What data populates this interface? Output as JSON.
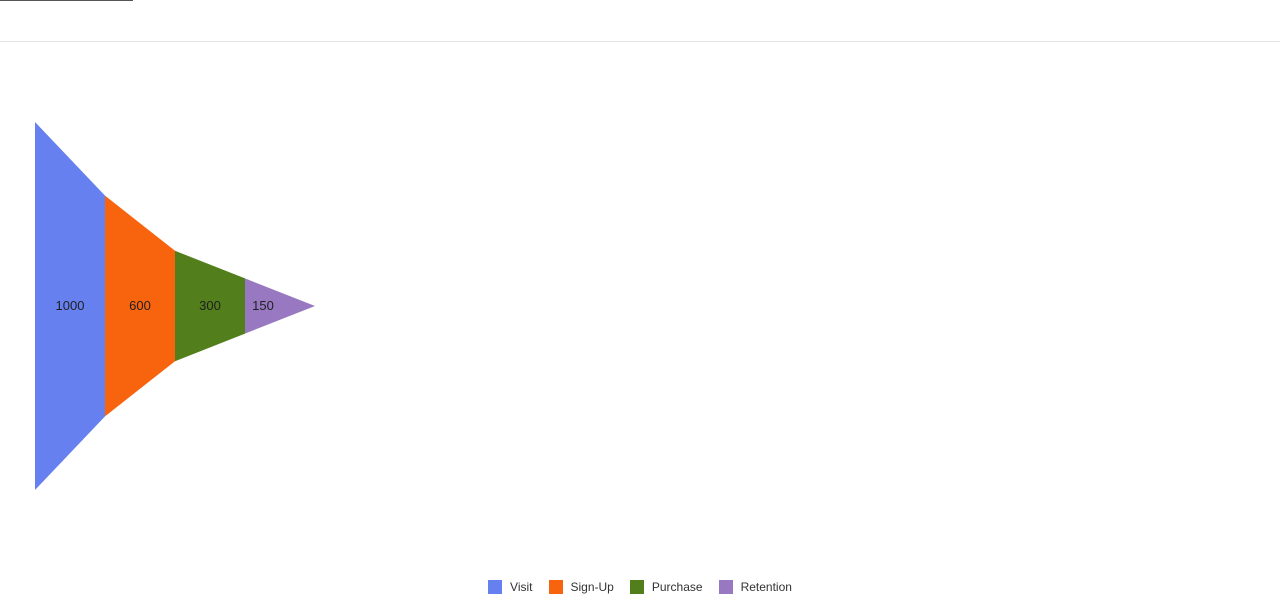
{
  "chart_data": {
    "type": "funnel",
    "categories": [
      "Visit",
      "Sign-Up",
      "Purchase",
      "Retention"
    ],
    "values": [
      1000,
      600,
      300,
      150
    ],
    "colors": [
      "#6680f0",
      "#f8640e",
      "#527f1b",
      "#9879c1"
    ],
    "legend": [
      "Visit",
      "Sign-Up",
      "Purchase",
      "Retention"
    ],
    "legend_position": "bottom",
    "orientation": "horizontal"
  }
}
